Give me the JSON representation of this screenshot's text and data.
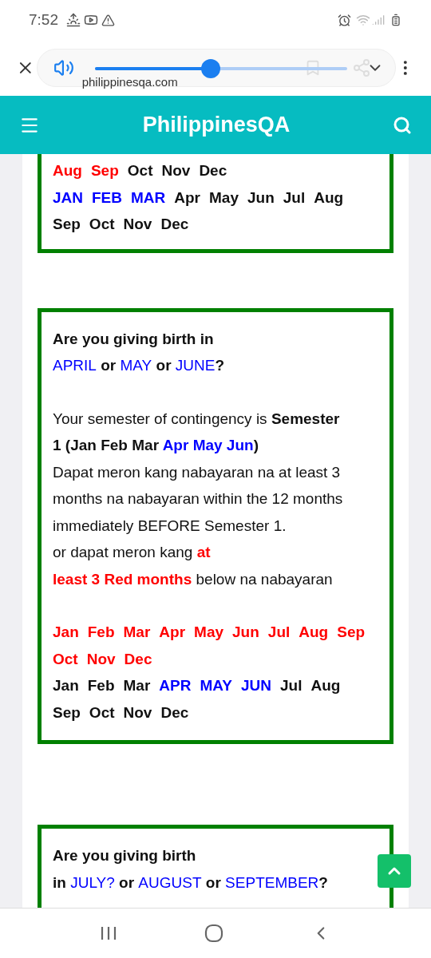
{
  "status_bar": {
    "time": "7:52"
  },
  "browser_bar": {
    "url": "philippinesqa.com",
    "volume": {
      "level": 0.46
    }
  },
  "header": {
    "brand": "PhilippinesQA"
  },
  "cards": [
    {
      "cut_top": true,
      "blocks": [
        {
          "kind": "months",
          "rows": [
            [
              {
                "text": "Aug",
                "color": "#ff0000"
              },
              {
                "text": "Sep",
                "color": "#ff0000"
              },
              {
                "text": "Oct",
                "color": "#111111"
              },
              {
                "text": "Nov",
                "color": "#111111"
              },
              {
                "text": "Dec",
                "color": "#111111"
              }
            ],
            [
              {
                "text": "JAN",
                "color": "#0000ff"
              },
              {
                "text": "FEB",
                "color": "#0000ff"
              },
              {
                "text": "MAR",
                "color": "#0000ff"
              },
              {
                "text": "Apr",
                "color": "#111111"
              },
              {
                "text": "May",
                "color": "#111111"
              },
              {
                "text": "Jun",
                "color": "#111111"
              },
              {
                "text": "Jul",
                "color": "#111111"
              },
              {
                "text": "Aug",
                "color": "#111111"
              }
            ],
            [
              {
                "text": "Sep",
                "color": "#111111"
              },
              {
                "text": "Oct",
                "color": "#111111"
              },
              {
                "text": "Nov",
                "color": "#111111"
              },
              {
                "text": "Dec",
                "color": "#111111"
              }
            ]
          ]
        }
      ]
    },
    {
      "cut_top": false,
      "blocks": [
        {
          "kind": "question",
          "lines": [
            [
              {
                "text": "Are you giving birth in",
                "color": "#111111",
                "bold": true
              }
            ],
            [
              {
                "text": "APRIL",
                "color": "#0000ff",
                "bold": false
              },
              {
                "text": " or ",
                "color": "#111111",
                "bold": true
              },
              {
                "text": "MAY",
                "color": "#0000ff",
                "bold": false
              },
              {
                "text": " or ",
                "color": "#111111",
                "bold": true
              },
              {
                "text": "JUNE",
                "color": "#0000ff",
                "bold": false
              },
              {
                "text": "?",
                "color": "#111111",
                "bold": true
              }
            ]
          ]
        },
        {
          "kind": "text",
          "lines": [
            [
              {
                "text": "Your semester of contingency is ",
                "color": "#111111",
                "bold": false
              },
              {
                "text": "Semester",
                "color": "#111111",
                "bold": true
              }
            ],
            [
              {
                "text": "1 (Jan Feb Mar ",
                "color": "#111111",
                "bold": true
              },
              {
                "text": "Apr May Jun",
                "color": "#0000ff",
                "bold": true
              },
              {
                "text": ")",
                "color": "#111111",
                "bold": true
              }
            ],
            [
              {
                "text": "Dapat meron kang nabayaran na at least 3",
                "color": "#111111",
                "bold": false
              }
            ],
            [
              {
                "text": "months na nabayaran within the 12 months",
                "color": "#111111",
                "bold": false
              }
            ],
            [
              {
                "text": "immediately BEFORE Semester 1.",
                "color": "#111111",
                "bold": false
              }
            ],
            [
              {
                "text": "or dapat meron kang ",
                "color": "#111111",
                "bold": false
              },
              {
                "text": "at",
                "color": "#ff0000",
                "bold": true
              }
            ],
            [
              {
                "text": "least 3 Red months",
                "color": "#ff0000",
                "bold": true
              },
              {
                "text": " below na nabayaran",
                "color": "#111111",
                "bold": false
              }
            ]
          ]
        },
        {
          "kind": "months",
          "rows": [
            [
              {
                "text": "Jan",
                "color": "#ff0000"
              },
              {
                "text": "Feb",
                "color": "#ff0000"
              },
              {
                "text": "Mar",
                "color": "#ff0000"
              },
              {
                "text": "Apr",
                "color": "#ff0000"
              },
              {
                "text": "May",
                "color": "#ff0000"
              },
              {
                "text": "Jun",
                "color": "#ff0000"
              },
              {
                "text": "Jul",
                "color": "#ff0000"
              },
              {
                "text": "Aug",
                "color": "#ff0000"
              },
              {
                "text": "Sep",
                "color": "#ff0000"
              }
            ],
            [
              {
                "text": "Oct",
                "color": "#ff0000"
              },
              {
                "text": "Nov",
                "color": "#ff0000"
              },
              {
                "text": "Dec",
                "color": "#ff0000"
              }
            ],
            [
              {
                "text": "Jan",
                "color": "#111111"
              },
              {
                "text": "Feb",
                "color": "#111111"
              },
              {
                "text": "Mar",
                "color": "#111111"
              },
              {
                "text": "APR",
                "color": "#0000ff"
              },
              {
                "text": "MAY",
                "color": "#0000ff"
              },
              {
                "text": "JUN",
                "color": "#0000ff"
              },
              {
                "text": "Jul",
                "color": "#111111"
              },
              {
                "text": "Aug",
                "color": "#111111"
              }
            ],
            [
              {
                "text": "Sep",
                "color": "#111111"
              },
              {
                "text": "Oct",
                "color": "#111111"
              },
              {
                "text": "Nov",
                "color": "#111111"
              },
              {
                "text": "Dec",
                "color": "#111111"
              }
            ]
          ]
        }
      ]
    },
    {
      "cut_top": false,
      "blocks": [
        {
          "kind": "question",
          "lines": [
            [
              {
                "text": "Are you giving birth",
                "color": "#111111",
                "bold": true
              }
            ],
            [
              {
                "text": "in ",
                "color": "#111111",
                "bold": true
              },
              {
                "text": "JULY?",
                "color": "#0000ff",
                "bold": false
              },
              {
                "text": " or ",
                "color": "#111111",
                "bold": true
              },
              {
                "text": "AUGUST",
                "color": "#0000ff",
                "bold": false
              },
              {
                "text": " or ",
                "color": "#111111",
                "bold": true
              },
              {
                "text": "SEPTEMBER",
                "color": "#0000ff",
                "bold": false
              },
              {
                "text": "?",
                "color": "#111111",
                "bold": true
              }
            ]
          ]
        }
      ]
    }
  ]
}
